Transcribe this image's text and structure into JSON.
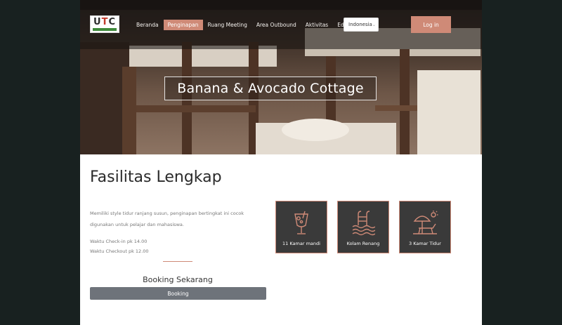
{
  "brand": {
    "logo_text_1": "U",
    "logo_text_2": "T",
    "logo_text_3": "C",
    "accent": "#cf8a77"
  },
  "nav": {
    "items": [
      {
        "label": "Beranda",
        "active": false
      },
      {
        "label": "Penginapan",
        "active": true
      },
      {
        "label": "Ruang Meeting",
        "active": false
      },
      {
        "label": "Area Outbound",
        "active": false
      },
      {
        "label": "Aktivitas",
        "active": false
      },
      {
        "label": "Eduwisata",
        "active": false
      }
    ],
    "language": "Indonesia",
    "login_label": "Log in"
  },
  "hero": {
    "title": "Banana & Avocado Cottage"
  },
  "content": {
    "heading": "Fasilitas Lengkap",
    "description": "Memiliki style tidur ranjang susun, penginapan bertingkat ini cocok digunakan untuk pelajar dan mahasiswa.",
    "checkin": "Waktu Check-in pk 14.00",
    "checkout": "Waktu Checkout pk 12.00",
    "booking_title": "Booking Sekarang",
    "booking_button": "Booking"
  },
  "features": [
    {
      "label": "11 Kamar mandi",
      "icon": "cocktail-icon"
    },
    {
      "label": "Kolam Renang",
      "icon": "pool-ladder-icon"
    },
    {
      "label": "3 Kamar Tidur",
      "icon": "beach-umbrella-icon"
    }
  ]
}
